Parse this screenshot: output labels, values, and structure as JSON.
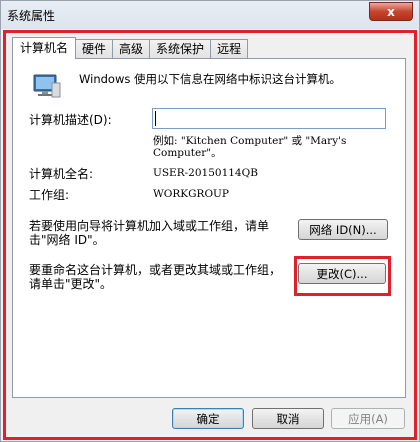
{
  "window": {
    "title": "系统属性",
    "close_label": "x"
  },
  "tabs": [
    "计算机名",
    "硬件",
    "高级",
    "系统保护",
    "远程"
  ],
  "panel": {
    "intro": "Windows 使用以下信息在网络中标识这台计算机。",
    "description_label": "计算机描述(D):",
    "description_value": "",
    "example": "例如: \"Kitchen Computer\" 或 \"Mary's Computer\"。",
    "fullname_label": "计算机全名:",
    "fullname_value": "USER-20150114QB",
    "workgroup_label": "工作组:",
    "workgroup_value": "WORKGROUP",
    "network_text": "若要使用向导将计算机加入域或工作组，请单击\"网络 ID\"。",
    "network_id_button": "网络 ID(N)...",
    "rename_text": "要重命名这台计算机，或者更改其域或工作组，请单击\"更改\"。",
    "change_button": "更改(C)..."
  },
  "footer": {
    "ok": "确定",
    "cancel": "取消",
    "apply": "应用(A)"
  },
  "colors": {
    "highlight": "#e0202a",
    "accent": "#3c7fb1"
  },
  "icons": {
    "computer": "computer-icon",
    "close": "close-icon"
  }
}
